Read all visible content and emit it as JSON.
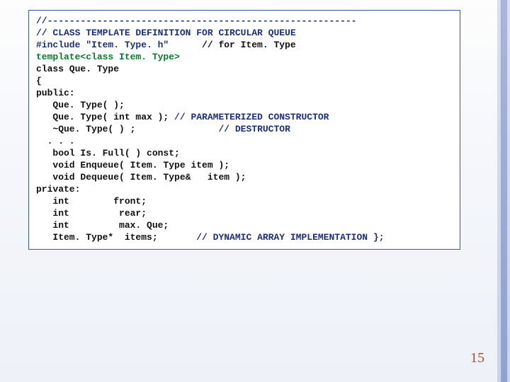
{
  "slide": {
    "page_number": "15"
  },
  "code": {
    "l01_a": "//--------------------------------------------------------",
    "l02_a": "// CLASS TEMPLATE DEFINITION FOR CIRCULAR QUEUE",
    "l03_a": "#include \"Item. Type. h\"",
    "l03_b": "      // for Item. Type",
    "l04_a": "template<class Item. Type>",
    "l05_a": "class Que. Type",
    "l06_a": "{",
    "l07_a": "public:",
    "l08_a": "   Que. Type( );",
    "l09_a": "   Que. Type( int max );",
    "l09_b": " // PARAMETERIZED CONSTRUCTOR",
    "l10_a": "   ~Que. Type( ) ;",
    "l10_b": "               // DESTRUCTOR",
    "l11_a": "  . . .",
    "l12_a": "   bool Is. Full( ) const;",
    "l13_a": "   void Enqueue( Item. Type item );",
    "l14_a": "   void Dequeue( Item. Type&   item );",
    "l15_a": "private:",
    "l16_a": "   int        front;",
    "l17_a": "   int         rear;",
    "l18_a": "   int         max. Que;",
    "l19_a": "   Item. Type*  items;",
    "l19_b": "       // DYNAMIC ARRAY IMPLEMENTATION };"
  }
}
